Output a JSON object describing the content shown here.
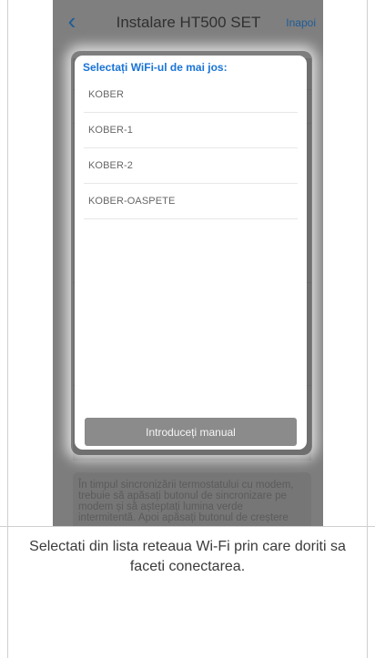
{
  "header": {
    "title": "Instalare HT500 SET",
    "back_label": "Inapoi"
  },
  "modal": {
    "heading": "Selectați WiFi-ul de mai jos:",
    "networks": [
      {
        "name": "KOBER"
      },
      {
        "name": "KOBER-1"
      },
      {
        "name": "KOBER-2"
      },
      {
        "name": "KOBER-OASPETE"
      }
    ],
    "manual_button_label": "Introduceți manual"
  },
  "background": {
    "instruction_text": "În timpul sincronizării termostatului cu modem, trebuie să apăsați butonul de sincronizare pe modem și să așteptați lumina verde intermitentă. Apoi apăsați butonul de creștere"
  },
  "caption": {
    "text": "Selectati din lista reteaua Wi-Fi prin care doriti sa faceti conectarea."
  }
}
